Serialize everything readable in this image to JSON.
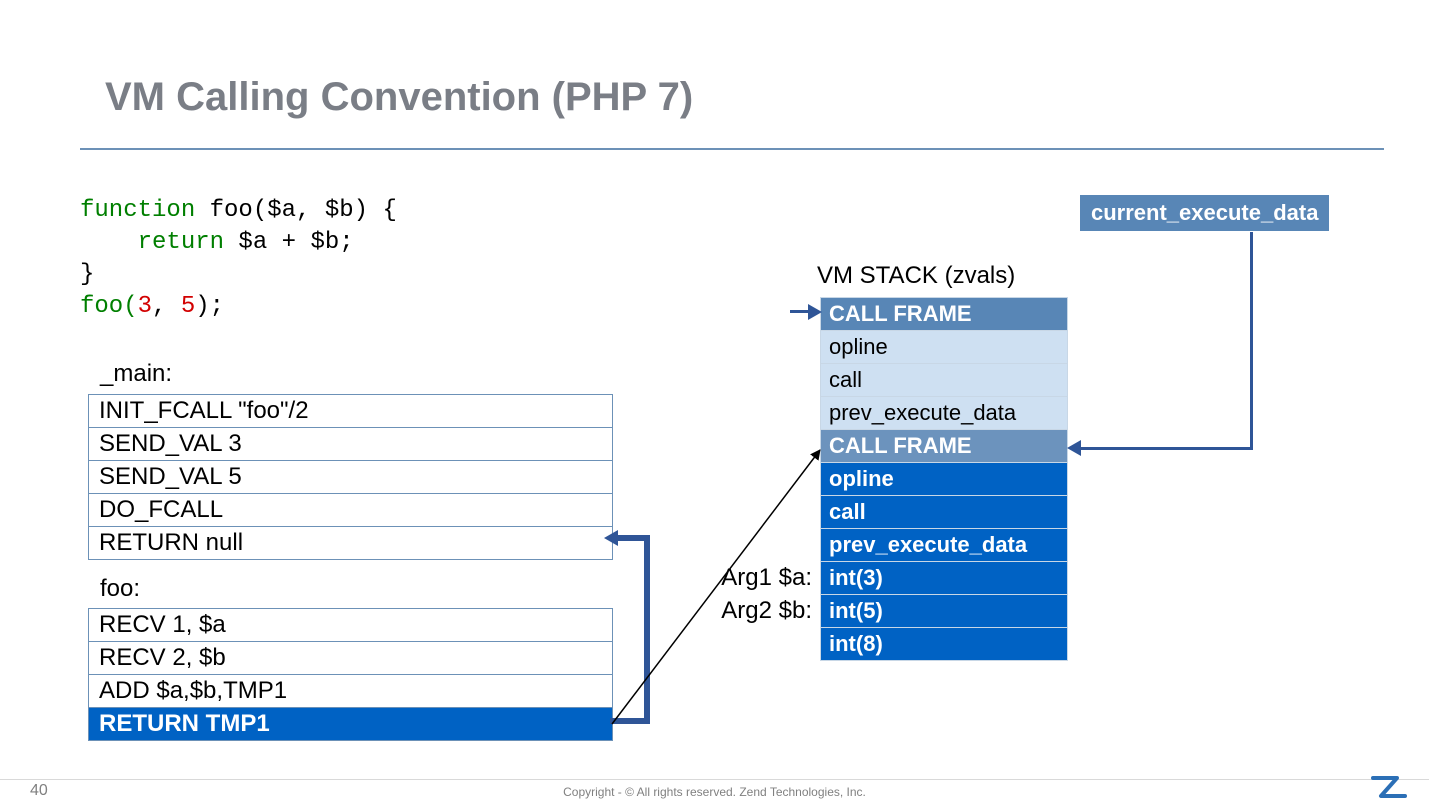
{
  "title": "VM Calling Convention (PHP 7)",
  "code": {
    "l1a": "function",
    "l1b": " foo($a, $b) {",
    "l2a": "    ",
    "l2b": "return",
    "l2c": " $a + $b;",
    "l3": "}",
    "l4a": "foo(",
    "l4b": "3",
    "l4c": ", ",
    "l4d": "5",
    "l4e": ");"
  },
  "main_label": "_main:",
  "main_ops": [
    "INIT_FCALL  \"foo\"/2",
    "SEND_VAL 3",
    "SEND_VAL 5",
    "DO_FCALL",
    "RETURN null"
  ],
  "foo_label": "foo:",
  "foo_ops": [
    "RECV 1, $a",
    "RECV 2, $b",
    "ADD $a,$b,TMP1",
    "RETURN TMP1"
  ],
  "foo_highlight_index": 3,
  "vm_stack_label": "VM STACK (zvals)",
  "stack": {
    "frame1": {
      "header": "CALL FRAME",
      "rows": [
        "opline",
        "call",
        "prev_execute_data"
      ]
    },
    "frame2": {
      "header": "CALL FRAME",
      "rows": [
        "opline",
        "call",
        "prev_execute_data",
        "int(3)",
        "int(5)",
        "int(8)"
      ]
    }
  },
  "arg_labels": [
    "Arg1 $a:",
    "Arg2 $b:"
  ],
  "ced_label": "current_execute_data",
  "footer": "Copyright - © All rights reserved. Zend Technologies, Inc.",
  "page": "40"
}
